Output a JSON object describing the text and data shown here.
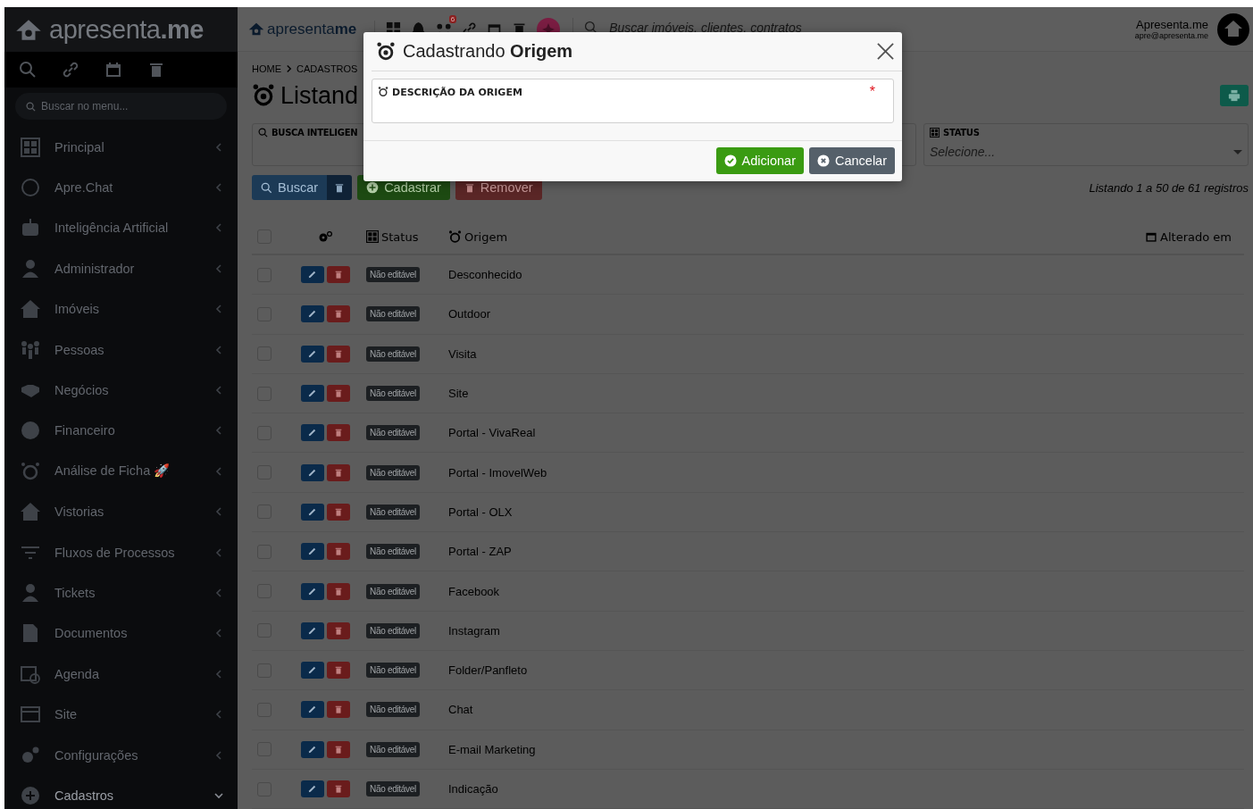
{
  "sidebar": {
    "logo": "apresenta**.me**",
    "search": {
      "placeholder": "Buscar no menu..."
    },
    "items": [
      {
        "label": "Principal",
        "expanded": false
      },
      {
        "label": "Apre.Chat",
        "expanded": false
      },
      {
        "label": "Inteligência Artificial",
        "expanded": false
      },
      {
        "label": "Administrador",
        "expanded": false
      },
      {
        "label": "Imóveis",
        "expanded": false
      },
      {
        "label": "Pessoas",
        "expanded": false
      },
      {
        "label": "Negócios",
        "expanded": false
      },
      {
        "label": "Financeiro",
        "expanded": false
      },
      {
        "label": "Análise de Ficha 🚀",
        "expanded": false
      },
      {
        "label": "Vistorias",
        "expanded": false
      },
      {
        "label": "Fluxos de Processos",
        "expanded": false
      },
      {
        "label": "Tickets",
        "expanded": false
      },
      {
        "label": "Documentos",
        "expanded": false
      },
      {
        "label": "Agenda",
        "expanded": false
      },
      {
        "label": "Site",
        "expanded": false
      },
      {
        "label": "Configurações",
        "expanded": false
      },
      {
        "label": "Cadastros",
        "expanded": true
      }
    ]
  },
  "header": {
    "logo": "apresenta**me**",
    "badge": "6",
    "search": {
      "placeholder": "Buscar imóveis, clientes, contratos"
    },
    "user": {
      "name": "Apresenta.me",
      "email": "apre@apresenta.me"
    }
  },
  "page": {
    "breadcrumb": [
      "HOME",
      "CADASTROS"
    ],
    "title": "Listand",
    "filters": [
      {
        "label": "BUSCA INTELIGEN"
      },
      {
        "label": "STATUS",
        "placeholder": "Selecione..."
      }
    ],
    "buttons": {
      "search": "Buscar",
      "add": "Cadastrar",
      "remove": "Remover"
    },
    "summary": "Listando 1 a 50 de 61 registros"
  },
  "table": {
    "select_all": {
      "checked": false
    },
    "columns": [
      "Status",
      "Origem",
      "Alterado em"
    ],
    "rows": [
      {
        "status": "Não editável",
        "origem": "Desconhecido",
        "checked": false
      },
      {
        "status": "Não editável",
        "origem": "Outdoor",
        "checked": false
      },
      {
        "status": "Não editável",
        "origem": "Visita",
        "checked": false
      },
      {
        "status": "Não editável",
        "origem": "Site",
        "checked": false
      },
      {
        "status": "Não editável",
        "origem": "Portal - VivaReal",
        "checked": false
      },
      {
        "status": "Não editável",
        "origem": "Portal - ImovelWeb",
        "checked": false
      },
      {
        "status": "Não editável",
        "origem": "Portal - OLX",
        "checked": false
      },
      {
        "status": "Não editável",
        "origem": "Portal - ZAP",
        "checked": false
      },
      {
        "status": "Não editável",
        "origem": "Facebook",
        "checked": false
      },
      {
        "status": "Não editável",
        "origem": "Instagram",
        "checked": false
      },
      {
        "status": "Não editável",
        "origem": "Folder/Panfleto",
        "checked": false
      },
      {
        "status": "Não editável",
        "origem": "Chat",
        "checked": false
      },
      {
        "status": "Não editável",
        "origem": "E-mail Marketing",
        "checked": false
      },
      {
        "status": "Não editável",
        "origem": "Indicação",
        "checked": false
      }
    ]
  },
  "modal": {
    "title": "Cadastrando **Origem**",
    "field": {
      "label": "DESCRIÇÃO DA ORIGEM",
      "required": "*"
    },
    "buttons": {
      "confirm": "Adicionar",
      "cancel": "Cancelar"
    }
  }
}
